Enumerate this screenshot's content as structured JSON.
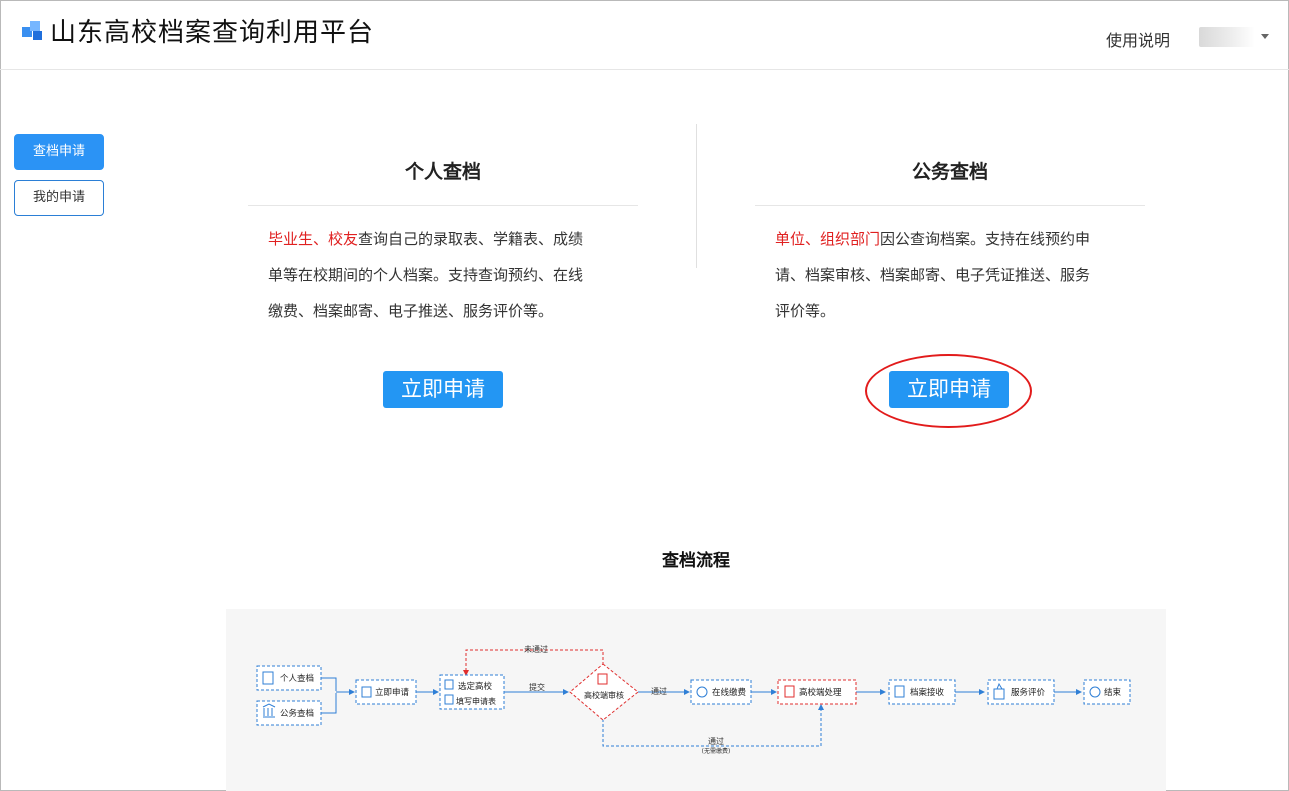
{
  "header": {
    "site_title": "山东高校档案查询利用平台",
    "help_label": "使用说明"
  },
  "sidebar": {
    "items": [
      {
        "label": "查档申请",
        "active": true
      },
      {
        "label": "我的申请",
        "active": false
      }
    ]
  },
  "cards": {
    "personal": {
      "title": "个人查档",
      "highlight1": "毕业生",
      "sep": "、",
      "highlight2": "校友",
      "line1_rest": "查询自己的录取表、学籍表、成绩",
      "line2": "单等在校期间的个人档案。支持查询预约、在线",
      "line3": "缴费、档案邮寄、电子推送、服务评价等。",
      "button": "立即申请"
    },
    "official": {
      "title": "公务查档",
      "highlight1": "单位",
      "sep": "、",
      "highlight2": "组织部门",
      "line1_rest": "因公查询档案。支持在线预约申",
      "line2": "请、档案审核、档案邮寄、电子凭证推送、服务",
      "line3": "评价等。",
      "button": "立即申请"
    }
  },
  "flow": {
    "title": "查档流程",
    "nodes": {
      "personal": "个人查档",
      "official": "公务查档",
      "apply": "立即申请",
      "select_school": "选定高校",
      "fill_form": "填写申请表",
      "review": "高校端审核",
      "pay": "在线缴费",
      "process": "高校端处理",
      "receive": "档案接收",
      "evaluate": "服务评价",
      "end": "结束"
    },
    "edges": {
      "submit": "提交",
      "pass": "通过",
      "fail": "未通过",
      "pass_free": "通过",
      "pass_free_note": "(无需缴费)"
    },
    "colors": {
      "blue": "#2f7fd6",
      "red": "#e02d2d"
    }
  }
}
